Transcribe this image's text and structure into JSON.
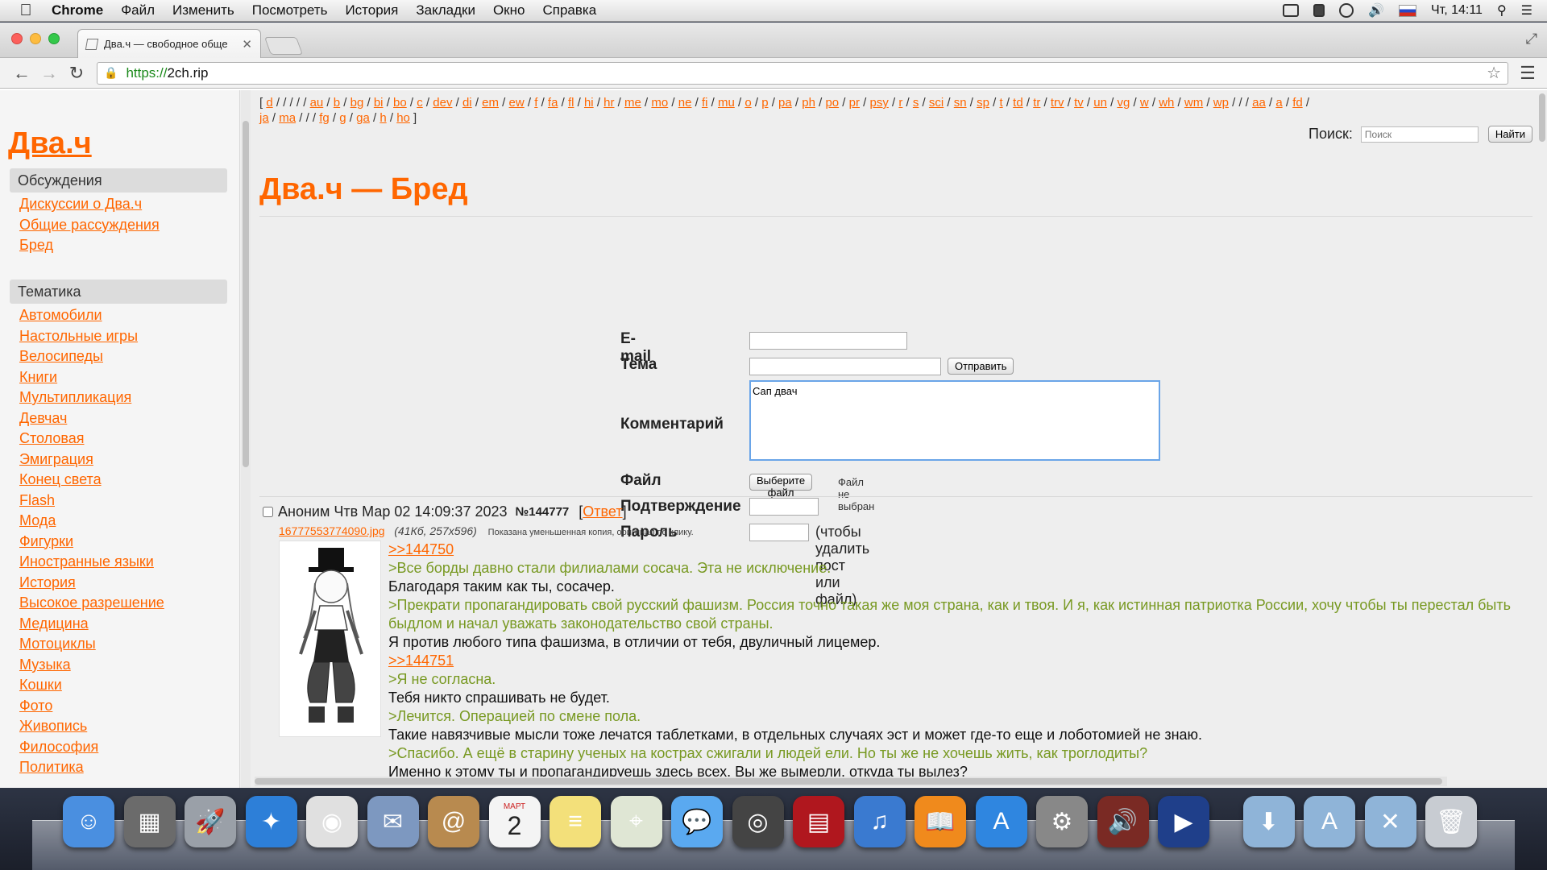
{
  "menubar": {
    "app_name": "Chrome",
    "items": [
      "Файл",
      "Изменить",
      "Посмотреть",
      "История",
      "Закладки",
      "Окно",
      "Справка"
    ],
    "clock": "Чт, 14:11"
  },
  "browser": {
    "tab_title": "Два.ч — свободное обще",
    "url_scheme": "https://",
    "url_host": "2ch.rip"
  },
  "sidebar": {
    "logo": "Два.ч",
    "sections": [
      {
        "title": "Обсуждения",
        "items": [
          "Дискуссии о Два.ч",
          "Общие рассуждения",
          "Бред"
        ]
      },
      {
        "title": "Тематика",
        "items": [
          "Автомобили",
          "Настольные игры",
          "Велосипеды",
          "Книги",
          "Мультипликация",
          "Девчач",
          "Столовая",
          "Эмиграция",
          "Конец света",
          "Flash",
          "Мода",
          "Фигурки",
          "Иностранные языки",
          "История",
          "Высокое разрешение",
          "Медицина",
          "Мотоциклы",
          "Музыка",
          "Кошки",
          "Фото",
          "Живопись",
          "Философия",
          "Политика"
        ]
      }
    ]
  },
  "board_links": {
    "row1": [
      "d",
      "/",
      "/",
      "au",
      "b",
      "bg",
      "bi",
      "bo",
      "c",
      "dev",
      "di",
      "em",
      "ew",
      "f",
      "fa",
      "fl",
      "hi",
      "hr",
      "me",
      "mo",
      "ne",
      "fi",
      "mu",
      "o",
      "p",
      "pa",
      "ph",
      "po",
      "pr",
      "psy",
      "r",
      "s",
      "sci",
      "sn",
      "sp",
      "t",
      "td",
      "tr",
      "trv",
      "tv",
      "un",
      "vg",
      "w",
      "wh",
      "wm",
      "wp",
      "/",
      "aa",
      "a",
      "fd"
    ],
    "row2": [
      "ja",
      "ma",
      "/",
      "fg",
      "g",
      "ga",
      "h",
      "ho"
    ]
  },
  "search": {
    "label": "Поиск:",
    "placeholder": "Поиск",
    "button": "Найти"
  },
  "board_title": "Два.ч — Бред",
  "form": {
    "email_label": "E-mail",
    "subject_label": "Тема",
    "submit": "Отправить",
    "comment_label": "Комментарий",
    "comment_value": "Сап двач",
    "file_label": "Файл",
    "file_button": "Выберите файл",
    "file_status": "Файл не выбран",
    "captcha_label": "Подтверждение",
    "password_label": "Пароль",
    "password_note": "(чтобы удалить пост или файл)"
  },
  "post": {
    "author": "Аноним",
    "date": "Чтв Мар 02 14:09:37 2023",
    "number": "№144777",
    "reply_link": "Ответ",
    "file_name": "16777553774090.jpg",
    "file_meta": "(41Кб, 257x596)",
    "file_note": "Показана уменьшенная копия, оригинал по клику.",
    "lines": [
      {
        "type": "reply",
        "text": ">>144750"
      },
      {
        "type": "quote",
        "text": ">Все борды давно стали филиалами сосача. Эта не исключение."
      },
      {
        "type": "text",
        "text": "Благодаря таким как ты, сосачер."
      },
      {
        "type": "quote",
        "text": ">Прекрати пропагандировать свой русский фашизм. Россия точно такая же моя страна, как и твоя. И я, как истинная патриотка России, хочу чтобы ты перестал быть быдлом и начал уважать законодательство свой страны."
      },
      {
        "type": "text",
        "text": "Я против любого типа фашизма, в отличии от тебя, двуличный лицемер."
      },
      {
        "type": "reply",
        "text": ">>144751"
      },
      {
        "type": "quote",
        "text": ">Я не согласна."
      },
      {
        "type": "text",
        "text": "Тебя никто спрашивать не будет."
      },
      {
        "type": "quote",
        "text": ">Лечится. Операцией по смене пола."
      },
      {
        "type": "text",
        "text": "Такие навязчивые мысли тоже лечатся таблетками, в отдельных случаях эст и может где-то еще и лоботомией не знаю."
      },
      {
        "type": "quote",
        "text": ">Спасибо. А ещё в старину ученых на кострах сжигали и людей ели. Но ты же не хочешь жить, как троглодиты?"
      },
      {
        "type": "text",
        "text": "Именно к этому ты и пропагандируешь здесь всех. Вы же вымерли, откуда ты вылез?"
      }
    ]
  },
  "dock": {
    "icons": [
      {
        "name": "finder-icon",
        "color": "#4a8fe0"
      },
      {
        "name": "photos-app-icon",
        "color": "#6b6b6b"
      },
      {
        "name": "launchpad-icon",
        "color": "#9aa0a8"
      },
      {
        "name": "safari-icon",
        "color": "#2d7fd8"
      },
      {
        "name": "chrome-icon",
        "color": "#e0e0e0"
      },
      {
        "name": "mail-stamp-icon",
        "color": "#7d98c0"
      },
      {
        "name": "contacts-icon",
        "color": "#b88a4f"
      },
      {
        "name": "calendar-icon",
        "color": "#f4f4f4"
      },
      {
        "name": "notes-icon",
        "color": "#f3e07a"
      },
      {
        "name": "maps-icon",
        "color": "#dfe6d4"
      },
      {
        "name": "messages-icon",
        "color": "#5aa9f0"
      },
      {
        "name": "facetime-icon",
        "color": "#444444"
      },
      {
        "name": "photo-booth-icon",
        "color": "#b0171e"
      },
      {
        "name": "itunes-icon",
        "color": "#3a7ad0"
      },
      {
        "name": "ibooks-icon",
        "color": "#f08a1c"
      },
      {
        "name": "app-store-icon",
        "color": "#2f86e0"
      },
      {
        "name": "system-preferences-icon",
        "color": "#888888"
      },
      {
        "name": "audiobook-icon",
        "color": "#7a2a24"
      },
      {
        "name": "quicktime-icon",
        "color": "#1f3f8a"
      },
      {
        "name": "downloads-folder-icon",
        "color": "#8fb4d8"
      },
      {
        "name": "applications-folder-icon",
        "color": "#8fb4d8"
      },
      {
        "name": "utilities-folder-icon",
        "color": "#8fb4d8"
      },
      {
        "name": "trash-icon",
        "color": "#c8ccd2"
      }
    ],
    "calendar_month": "МАРТ",
    "calendar_day": "2"
  },
  "colors": {
    "accent": "#ff6600",
    "quote": "#789922"
  }
}
